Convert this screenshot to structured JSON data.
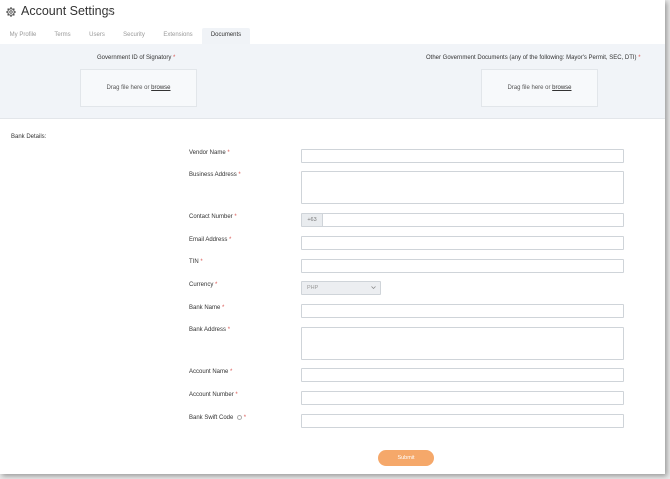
{
  "header": {
    "title": "Account Settings"
  },
  "tabs": [
    {
      "label": "My Profile"
    },
    {
      "label": "Terms"
    },
    {
      "label": "Users"
    },
    {
      "label": "Security"
    },
    {
      "label": "Extensions"
    },
    {
      "label": "Documents",
      "active": true
    }
  ],
  "uploads": {
    "left_label": "Government ID of Signatory",
    "right_label": "Other Government Documents (any of the following: Mayor's Permit, SEC, DTI)",
    "required_mark": "*",
    "drop_text": "Drag file here or",
    "browse_label": "browse"
  },
  "bank": {
    "section_title": "Bank Details:",
    "required_mark": "*",
    "vendor_name_label": "Vendor Name",
    "business_address_label": "Business Address",
    "contact_number_label": "Contact Number",
    "contact_prefix": "+63",
    "email_label": "Email Address",
    "tin_label": "TIN",
    "currency_label": "Currency",
    "currency_value": "PHP",
    "bank_name_label": "Bank Name",
    "bank_address_label": "Bank Address",
    "account_name_label": "Account Name",
    "account_number_label": "Account Number",
    "swift_label": "Bank Swift Code"
  },
  "submit_label": "Submit"
}
